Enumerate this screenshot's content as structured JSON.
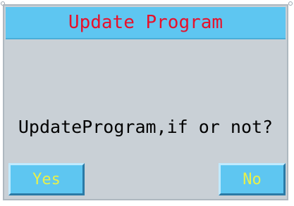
{
  "dialog": {
    "title": "Update Program",
    "message": "UpdateProgram,if or not?",
    "buttons": {
      "yes_label": "Yes",
      "no_label": "No"
    }
  },
  "colors": {
    "title_bar": "#5ec6f1",
    "title_text": "#e8102a",
    "dialog_bg": "#c9d0d6",
    "button_bg": "#5ec6f1",
    "button_text": "#e8f04a"
  }
}
